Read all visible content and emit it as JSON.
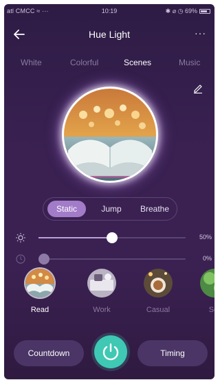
{
  "status": {
    "carrier": "atl CMCC ≈ ···",
    "time": "10:19",
    "right": "✱ ⌀ ◷ 69%"
  },
  "header": {
    "title": "Hue Light",
    "more": "···"
  },
  "tabs": [
    {
      "label": "White"
    },
    {
      "label": "Colorful"
    },
    {
      "label": "Scenes"
    },
    {
      "label": "Music"
    }
  ],
  "segment": {
    "items": [
      {
        "label": "Static"
      },
      {
        "label": "Jump"
      },
      {
        "label": "Breathe"
      }
    ],
    "selected": "Static"
  },
  "sliders": {
    "brightness": {
      "value": 50,
      "label": "50%"
    },
    "second": {
      "value": 0,
      "label": "0%"
    }
  },
  "scenes": [
    {
      "label": "Read"
    },
    {
      "label": "Work"
    },
    {
      "label": "Casual"
    },
    {
      "label": "Sof"
    }
  ],
  "bottom": {
    "countdown": "Countdown",
    "timing": "Timing"
  },
  "colors": {
    "accent": "#a27cc9",
    "power": "#3fc8b4",
    "background": "#3a2152"
  }
}
